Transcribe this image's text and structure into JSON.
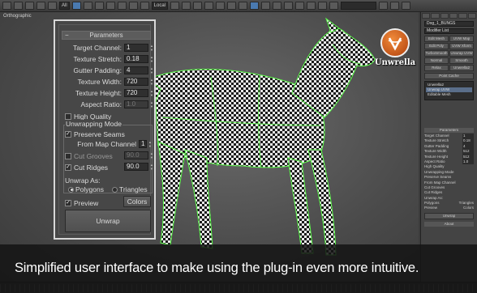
{
  "toolbar": {
    "selection_filter": "All",
    "coord_system": "Local"
  },
  "viewport": {
    "label": "Orthographic"
  },
  "logo": {
    "text": "Unwrella"
  },
  "panel": {
    "title": "Parameters",
    "target_channel": {
      "label": "Target Channel:",
      "value": "1"
    },
    "texture_stretch": {
      "label": "Texture Stretch:",
      "value": "0.18"
    },
    "gutter_padding": {
      "label": "Gutter Padding:",
      "value": "4"
    },
    "texture_width": {
      "label": "Texture Width:",
      "value": "720"
    },
    "texture_height": {
      "label": "Texture Height:",
      "value": "720"
    },
    "aspect_ratio": {
      "label": "Aspect Ratio:",
      "value": "1.0"
    },
    "high_quality": {
      "label": "High Quality",
      "checked": false
    },
    "unwrapping_mode": {
      "title": "Unwrapping Mode"
    },
    "preserve_seams": {
      "label": "Preserve Seams",
      "checked": true
    },
    "from_map_channel": {
      "label": "From Map Channel",
      "value": "1"
    },
    "cut_grooves": {
      "label": "Cut Grooves",
      "value": "90.0",
      "checked": false
    },
    "cut_ridges": {
      "label": "Cut Ridges",
      "value": "90.0",
      "checked": true
    },
    "unwrap_as": {
      "label": "Unwrap As:",
      "polygons": "Polygons",
      "triangles": "Triangles",
      "selected": "polygons"
    },
    "preview": {
      "label": "Preview",
      "checked": true
    },
    "colors_button": "Colors",
    "unwrap_button": "Unwrap"
  },
  "command_panel": {
    "object_name": "Dog_1_BUNGS",
    "modifier_list": "Modifier List",
    "buttons": [
      "Edit Mesh",
      "UVW Map",
      "Edit Poly",
      "UVW Xform",
      "TurboSmooth",
      "Unwrap UVW",
      "Normal",
      "Smooth",
      "Relax",
      "Unwrella2"
    ],
    "point_cache": "Point Cache",
    "stack": [
      "Unwrella2",
      "Unwrap UVW",
      "Editable Mesh"
    ],
    "params_title": "Parameters",
    "rows": [
      {
        "label": "Target Channel",
        "value": "1"
      },
      {
        "label": "Texture Stretch",
        "value": "0.18"
      },
      {
        "label": "Gutter Padding",
        "value": "4"
      },
      {
        "label": "Texture Width",
        "value": "512"
      },
      {
        "label": "Texture Height",
        "value": "512"
      },
      {
        "label": "Aspect Ratio",
        "value": "1.0"
      }
    ],
    "high_quality": "High Quality",
    "unwrapping_mode": "Unwrapping Mode",
    "preserve_seams": "Preserve Seams",
    "from_map_channel": "From Map Channel",
    "cut_grooves": "Cut Grooves",
    "cut_ridges": "Cut Ridges",
    "unwrap_as": "Unwrap As:",
    "polygons": "Polygons",
    "triangles": "Triangles",
    "preview": "Preview",
    "colors": "Colors",
    "unwrap": "Unwrap",
    "about": "About"
  },
  "caption": "Simplified user interface to make using the plug-in even more intuitive."
}
